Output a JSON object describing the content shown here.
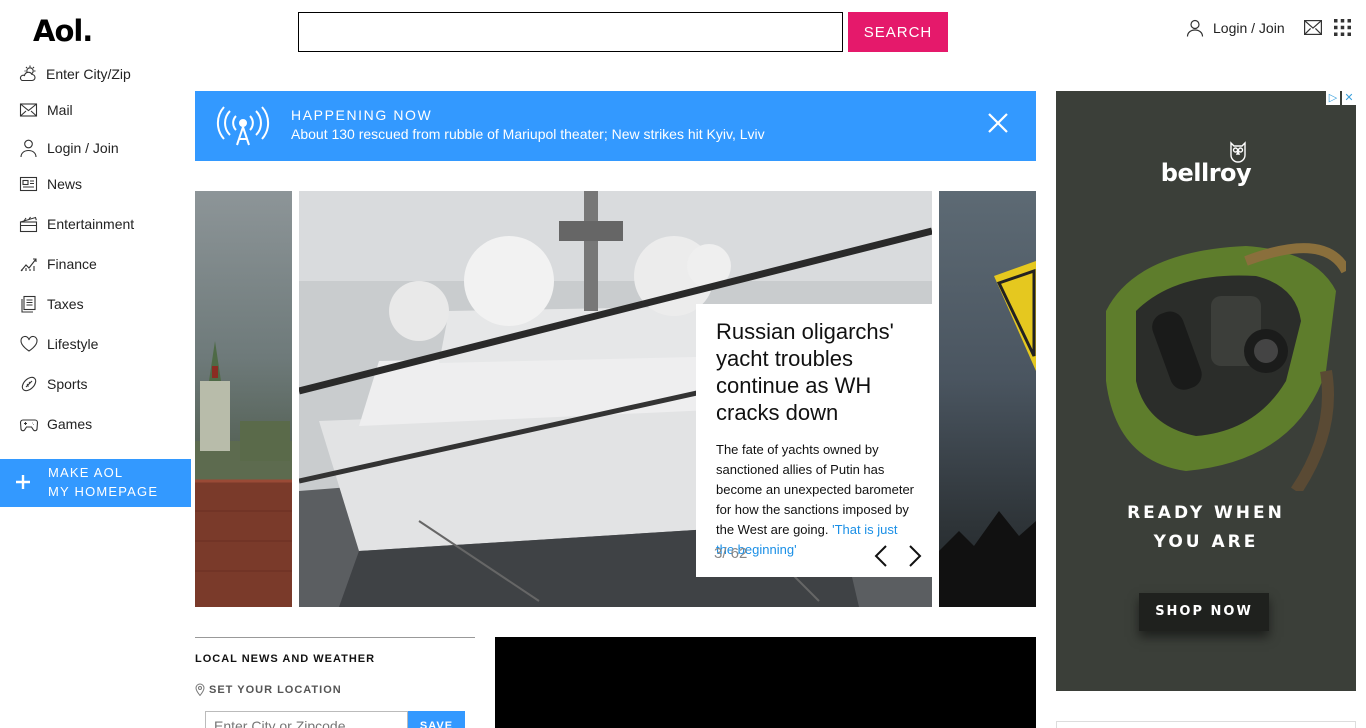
{
  "header": {
    "logo": "Aol.",
    "search_button": "SEARCH",
    "search_value": "",
    "login_label": "Login / Join"
  },
  "sidebar": {
    "items": [
      {
        "label": "Enter City/Zip",
        "icon": "weather-icon"
      },
      {
        "label": "Mail",
        "icon": "mail-icon"
      },
      {
        "label": "Login / Join",
        "icon": "user-icon"
      },
      {
        "label": "News",
        "icon": "news-icon"
      },
      {
        "label": "Entertainment",
        "icon": "clapperboard-icon"
      },
      {
        "label": "Finance",
        "icon": "chart-icon"
      },
      {
        "label": "Taxes",
        "icon": "documents-icon"
      },
      {
        "label": "Lifestyle",
        "icon": "heart-icon"
      },
      {
        "label": "Sports",
        "icon": "football-icon"
      },
      {
        "label": "Games",
        "icon": "gamepad-icon"
      }
    ],
    "make_homepage_line1": "MAKE AOL",
    "make_homepage_line2": "MY HOMEPAGE"
  },
  "happening": {
    "title": "HAPPENING NOW",
    "text": "About 130 rescued from rubble of Mariupol theater; New strikes hit Kyiv, Lviv"
  },
  "carousel": {
    "title": "Russian oligarchs' yacht troubles continue as WH cracks down",
    "body": "The fate of yachts owned by sanctioned allies of Putin has become an unexpected barometer for how the sanctions imposed by the West are going.",
    "link": "'That is just the beginning'",
    "counter": "3/ 62"
  },
  "local": {
    "title": "LOCAL NEWS AND WEATHER",
    "set_location": "SET YOUR LOCATION",
    "placeholder": "Enter City or Zipcode",
    "save": "SAVE"
  },
  "ad": {
    "brand": "bellroy",
    "headline_line1": "READY WHEN",
    "headline_line2": "YOU ARE",
    "cta": "SHOP NOW"
  },
  "colors": {
    "accent_pink": "#e5196b",
    "accent_blue": "#3399ff"
  }
}
